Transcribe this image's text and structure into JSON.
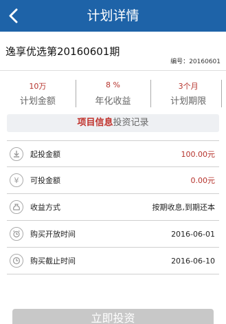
{
  "header": {
    "title": "计划详情"
  },
  "plan": {
    "name": "逸享优选第20160601期",
    "code_label": "编号：",
    "code_value": "20160601"
  },
  "stats": [
    {
      "value": "10万",
      "label": "计划金额"
    },
    {
      "value": "8 %",
      "label": "年化收益"
    },
    {
      "value": "3个月",
      "label": "计划期限"
    }
  ],
  "tabs": {
    "active": "项目信息",
    "other": "投资记录"
  },
  "rows": [
    {
      "icon": "download-icon",
      "label": "起投金额",
      "value": "100.00元",
      "red": true
    },
    {
      "icon": "yen-icon",
      "label": "可投金额",
      "value": "0.00元",
      "red": true
    },
    {
      "icon": "money-bag-icon",
      "label": "收益方式",
      "value": "按期收息,到期还本",
      "red": false
    },
    {
      "icon": "alarm-clock-icon",
      "label": "购买开放时间",
      "value": "2016-06-01",
      "red": false
    },
    {
      "icon": "clock-icon",
      "label": "购买截止时间",
      "value": "2016-06-10",
      "red": false
    }
  ],
  "button": {
    "label": "立即投资"
  },
  "colors": {
    "header": "#1e63a8",
    "accent_red": "#b5322b",
    "button_disabled": "#c8c8c8"
  }
}
